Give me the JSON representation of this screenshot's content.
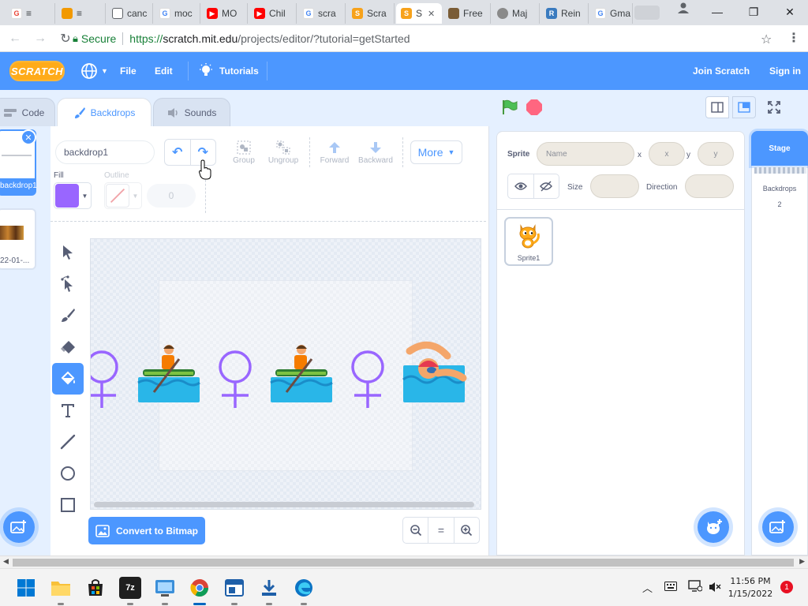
{
  "browser": {
    "tabs": [
      {
        "label": "≡",
        "color": "#ea4335",
        "fav": "G"
      },
      {
        "label": "≡",
        "color": "#f29900",
        "fav": "■"
      },
      {
        "label": "canc",
        "color": "#5f6368",
        "fav": "□"
      },
      {
        "label": "moc",
        "color": "#4285f4",
        "fav": "G"
      },
      {
        "label": "MO",
        "color": "#ff0000",
        "fav": "▶"
      },
      {
        "label": "Chil",
        "color": "#ff0000",
        "fav": "▶"
      },
      {
        "label": "scra",
        "color": "#4285f4",
        "fav": "G"
      },
      {
        "label": "Scra",
        "color": "#f7a21b",
        "fav": "S"
      },
      {
        "label": "S",
        "color": "#f7a21b",
        "fav": "S"
      },
      {
        "label": "Free",
        "color": "#7a5c36",
        "fav": "▣"
      },
      {
        "label": "Maj",
        "color": "#8a8a8a",
        "fav": "◎"
      },
      {
        "label": "Rein",
        "color": "#3a7bbf",
        "fav": "R"
      },
      {
        "label": "Gma",
        "color": "#4285f4",
        "fav": "G"
      }
    ],
    "secure_label": "Secure",
    "url_proto": "https://",
    "url_host": "scratch.mit.edu",
    "url_rest": "/projects/editor/?tutorial=getStarted"
  },
  "menu": {
    "logo": "SCRATCH",
    "file": "File",
    "edit": "Edit",
    "tutorials": "Tutorials",
    "join": "Join Scratch",
    "signin": "Sign in"
  },
  "editor_tabs": {
    "code": "Code",
    "backdrops": "Backdrops",
    "sounds": "Sounds"
  },
  "backdrop_list": [
    {
      "label": "backdrop1",
      "selected": true
    },
    {
      "label": "22-01-...",
      "selected": false
    }
  ],
  "paint": {
    "name_value": "backdrop1",
    "group": "Group",
    "ungroup": "Ungroup",
    "forward": "Forward",
    "backward": "Backward",
    "more": "More",
    "fill_label": "Fill",
    "outline_label": "Outline",
    "fill_color": "#9966ff",
    "outline_width": "0",
    "convert": "Convert to Bitmap",
    "zoom_reset": "="
  },
  "sprite_info": {
    "sprite_label": "Sprite",
    "name_placeholder": "Name",
    "x_label": "x",
    "x_placeholder": "x",
    "y_label": "y",
    "y_placeholder": "y",
    "size_label": "Size",
    "direction_label": "Direction"
  },
  "sprites": [
    {
      "name": "Sprite1"
    }
  ],
  "stage": {
    "header": "Stage",
    "backdrops_label": "Backdrops",
    "backdrops_count": "2"
  },
  "taskbar": {
    "time": "11:56 PM",
    "date": "1/15/2022",
    "notifications": "1"
  },
  "colors": {
    "scratch_blue": "#4c97ff",
    "scratch_orange": "#ffab19",
    "flag_green": "#4cbf56",
    "stop_red": "#ff6680"
  }
}
